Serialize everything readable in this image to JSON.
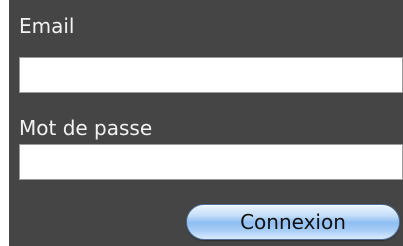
{
  "login_form": {
    "email_label": "Email",
    "email_value": "",
    "password_label": "Mot de passe",
    "password_value": "",
    "submit_label": "Connexion"
  }
}
